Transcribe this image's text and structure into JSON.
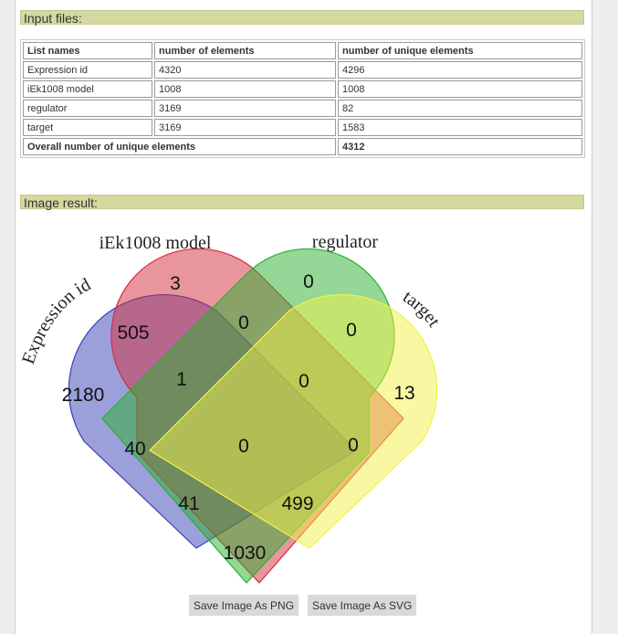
{
  "sections": {
    "input_files": "Input files:",
    "image_result": "Image result:"
  },
  "table": {
    "headers": [
      "List names",
      "number of elements",
      "number of unique elements"
    ],
    "rows": [
      [
        "Expression id",
        "4320",
        "4296"
      ],
      [
        "iEk1008 model",
        "1008",
        "1008"
      ],
      [
        "regulator",
        "3169",
        "82"
      ],
      [
        "target",
        "3169",
        "1583"
      ]
    ],
    "total_label": "Overall number of unique elements",
    "total_value": "4312"
  },
  "venn": {
    "set_labels": [
      "Expression id",
      "iEk1008 model",
      "regulator",
      "target"
    ],
    "colors": [
      "#3742b5",
      "#d32b3d",
      "#29b02f",
      "#f2f247"
    ],
    "region_values": [
      "3",
      "0",
      "505",
      "0",
      "0",
      "2180",
      "1",
      "0",
      "13",
      "40",
      "0",
      "0",
      "41",
      "499",
      "1030"
    ]
  },
  "buttons": {
    "save_png": "Save Image As PNG",
    "save_svg": "Save Image As SVG"
  }
}
